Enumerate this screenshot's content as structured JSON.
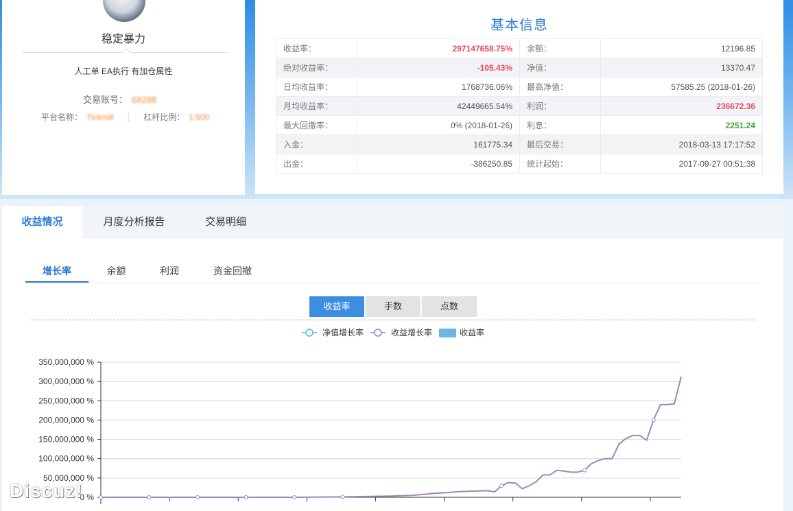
{
  "profile": {
    "name": "稳定暴力",
    "tags": "人工单 EA执行 有加仓属性",
    "account_label": "交易账号：",
    "account_value": "68288",
    "platform_label": "平台名称：",
    "platform_value": "Tickmill",
    "leverage_label": "杠杆比例：",
    "leverage_value": "1:500"
  },
  "info": {
    "title": "基本信息",
    "rows": [
      {
        "l1": "收益率：",
        "v1": "297147658.75%",
        "c1": "red",
        "l2": "余额：",
        "v2": "12196.85",
        "c2": ""
      },
      {
        "l1": "绝对收益率：",
        "v1": "-105.43%",
        "c1": "red",
        "l2": "净值：",
        "v2": "13370.47",
        "c2": ""
      },
      {
        "l1": "日均收益率：",
        "v1": "1768736.06%",
        "c1": "",
        "l2": "最高净值：",
        "v2": "57585.25 (2018-01-26)",
        "c2": ""
      },
      {
        "l1": "月均收益率：",
        "v1": "42449665.54%",
        "c1": "",
        "l2": "利润：",
        "v2": "236672.36",
        "c2": "red"
      },
      {
        "l1": "最大回撤率：",
        "v1": "0% (2018-01-26)",
        "c1": "",
        "l2": "利息：",
        "v2": "2251.24",
        "c2": "green"
      },
      {
        "l1": "入金：",
        "v1": "161775.34",
        "c1": "",
        "l2": "最后交易：",
        "v2": "2018-03-13 17:17:52",
        "c2": ""
      },
      {
        "l1": "出金：",
        "v1": "-386250.85",
        "c1": "",
        "l2": "统计起始：",
        "v2": "2017-09-27 00:51:38",
        "c2": ""
      }
    ]
  },
  "tabs": [
    "收益情况",
    "月度分析报告",
    "交易明细"
  ],
  "subtabs": [
    "增长率",
    "余额",
    "利润",
    "资金回撤"
  ],
  "segments": [
    "收益率",
    "手数",
    "点数"
  ],
  "colors": {
    "accent": "#2d7bd4",
    "red": "#e84a5f",
    "green": "#3aa72e",
    "line_net": "#5bb6e6",
    "line_profit": "#a583b6",
    "bar": "#6bb7e2"
  },
  "watermark": "Discuz!",
  "chart_data": {
    "type": "line",
    "legend": [
      "净值增长率",
      "收益增长率",
      "收益率"
    ],
    "y_ticks": [
      "350,000,000 %",
      "300,000,000 %",
      "250,000,000 %",
      "200,000,000 %",
      "150,000,000 %",
      "100,000,000 %",
      "50,000,000 %",
      "0 %"
    ],
    "ylim": [
      0,
      350000000
    ],
    "x": [
      0,
      7,
      14,
      21,
      28,
      35,
      42,
      45,
      47,
      48,
      50,
      52,
      54,
      56,
      57,
      58,
      59,
      60,
      61,
      62,
      63,
      64,
      65,
      66,
      67,
      68,
      69,
      70,
      71,
      72,
      73,
      74,
      75,
      76,
      77,
      78,
      79,
      80,
      81,
      82,
      83,
      84
    ],
    "series": [
      {
        "name": "收益增长率",
        "values": [
          0,
          0,
          0,
          0,
          0,
          1000000,
          3000000,
          5000000,
          8000000,
          10000000,
          12000000,
          15000000,
          16000000,
          17000000,
          14000000,
          30000000,
          38000000,
          37000000,
          22000000,
          30000000,
          40000000,
          58000000,
          58000000,
          70000000,
          68000000,
          65000000,
          65000000,
          70000000,
          87000000,
          95000000,
          100000000,
          100000000,
          138000000,
          152000000,
          160000000,
          160000000,
          148000000,
          200000000,
          240000000,
          240000000,
          242000000,
          312000000
        ]
      }
    ]
  }
}
